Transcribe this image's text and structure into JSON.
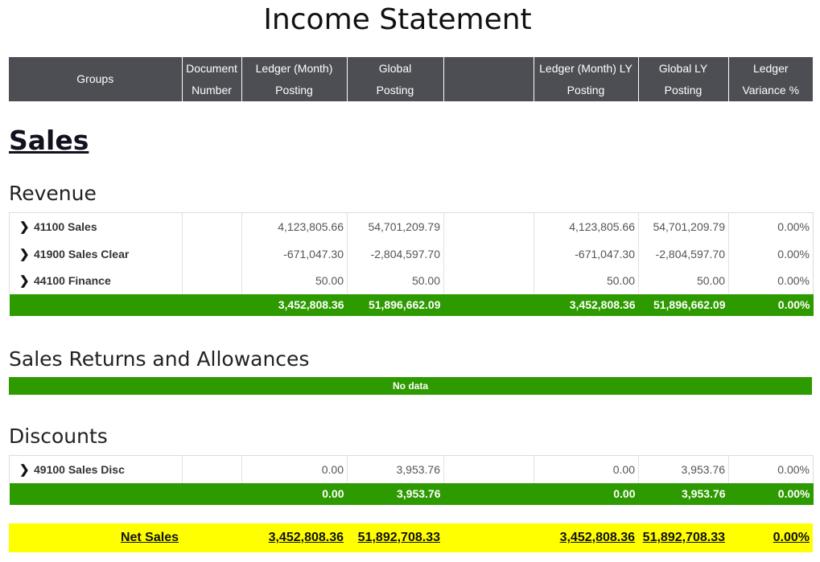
{
  "title": "Income Statement",
  "columns": [
    {
      "line1": "Groups",
      "line2": ""
    },
    {
      "line1": "Document",
      "line2": "Number"
    },
    {
      "line1": "Ledger (Month)",
      "line2": "Posting"
    },
    {
      "line1": "Global",
      "line2": "Posting"
    },
    {
      "line1": "",
      "line2": ""
    },
    {
      "line1": "Ledger (Month) LY",
      "line2": "Posting"
    },
    {
      "line1": "Global LY",
      "line2": "Posting"
    },
    {
      "line1": "Ledger",
      "line2": "Variance %"
    }
  ],
  "section": "Sales",
  "revenue": {
    "title": "Revenue",
    "rows": [
      {
        "account": "41100 Sales",
        "doc": "",
        "ledger": "4,123,805.66",
        "global": "54,701,209.79",
        "blank": "",
        "ledger_ly": "4,123,805.66",
        "global_ly": "54,701,209.79",
        "variance": "0.00%"
      },
      {
        "account": "41900 Sales Clear",
        "doc": "",
        "ledger": "-671,047.30",
        "global": "-2,804,597.70",
        "blank": "",
        "ledger_ly": "-671,047.30",
        "global_ly": "-2,804,597.70",
        "variance": "0.00%"
      },
      {
        "account": "44100 Finance",
        "doc": "",
        "ledger": "50.00",
        "global": "50.00",
        "blank": "",
        "ledger_ly": "50.00",
        "global_ly": "50.00",
        "variance": "0.00%"
      }
    ],
    "total": {
      "ledger": "3,452,808.36",
      "global": "51,896,662.09",
      "ledger_ly": "3,452,808.36",
      "global_ly": "51,896,662.09",
      "variance": "0.00%"
    }
  },
  "returns": {
    "title": "Sales Returns and Allowances",
    "no_data": "No data"
  },
  "discounts": {
    "title": "Discounts",
    "rows": [
      {
        "account": "49100 Sales Disc",
        "doc": "",
        "ledger": "0.00",
        "global": "3,953.76",
        "blank": "",
        "ledger_ly": "0.00",
        "global_ly": "3,953.76",
        "variance": "0.00%"
      }
    ],
    "total": {
      "ledger": "0.00",
      "global": "3,953.76",
      "ledger_ly": "0.00",
      "global_ly": "3,953.76",
      "variance": "0.00%"
    }
  },
  "net_sales": {
    "label": "Net Sales",
    "ledger": "3,452,808.36",
    "global": "51,892,708.33",
    "ledger_ly": "3,452,808.36",
    "global_ly": "51,892,708.33",
    "variance": "0.00%"
  },
  "colors": {
    "header_bg": "#4d4e54",
    "total_bg": "#2d9a00",
    "net_bg": "#ffff00"
  }
}
